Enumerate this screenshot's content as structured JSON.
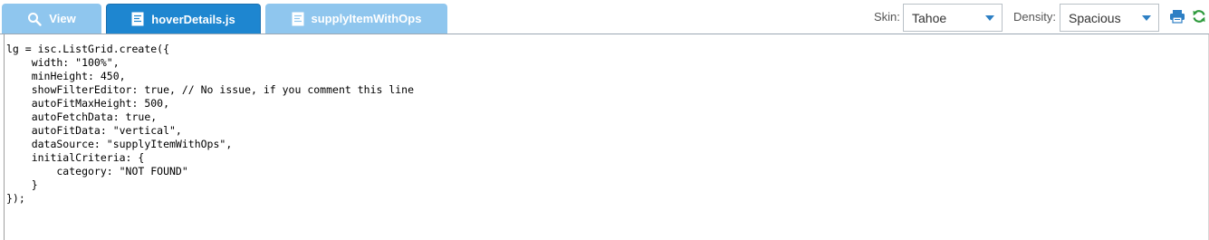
{
  "tabs": [
    {
      "label": "View",
      "icon": "search-icon"
    },
    {
      "label": "hoverDetails.js",
      "icon": "document-icon"
    },
    {
      "label": "supplyItemWithOps",
      "icon": "document-icon"
    }
  ],
  "controls": {
    "skin_label": "Skin:",
    "skin_value": "Tahoe",
    "density_label": "Density:",
    "density_value": "Spacious"
  },
  "colors": {
    "active_tab": "#1e86d0",
    "inactive_tab": "#8fc6ee",
    "print_icon": "#2d7fc4",
    "refresh_icon": "#2e9a3c"
  },
  "editor": {
    "code": "lg = isc.ListGrid.create({\n    width: \"100%\",\n    minHeight: 450,\n    showFilterEditor: true, // No issue, if you comment this line\n    autoFitMaxHeight: 500,\n    autoFetchData: true,\n    autoFitData: \"vertical\",\n    dataSource: \"supplyItemWithOps\",\n    initialCriteria: {\n        category: \"NOT FOUND\"\n    }\n});"
  }
}
